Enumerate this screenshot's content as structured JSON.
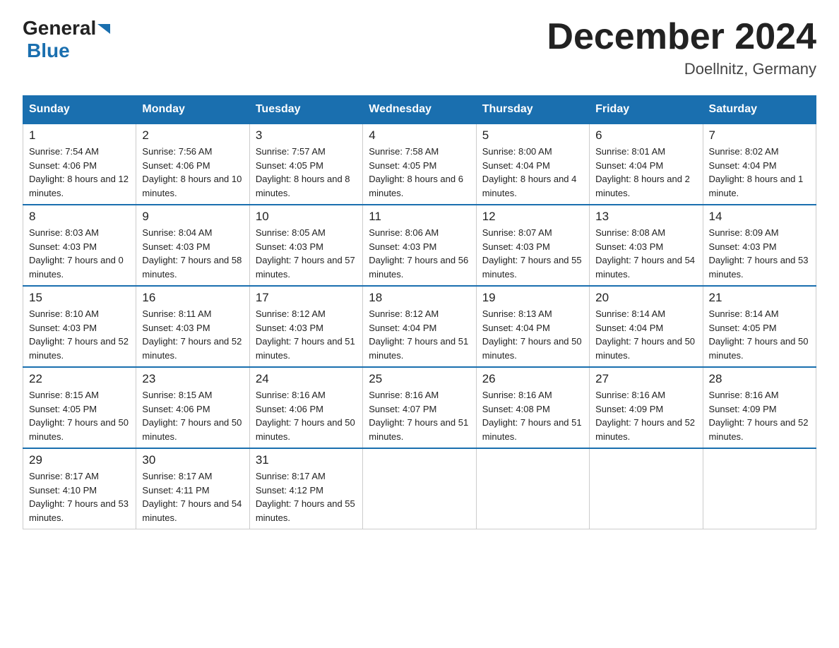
{
  "header": {
    "logo_text_general": "General",
    "logo_text_blue": "Blue",
    "title": "December 2024",
    "subtitle": "Doellnitz, Germany"
  },
  "days_of_week": [
    "Sunday",
    "Monday",
    "Tuesday",
    "Wednesday",
    "Thursday",
    "Friday",
    "Saturday"
  ],
  "weeks": [
    [
      {
        "day": "1",
        "sunrise": "7:54 AM",
        "sunset": "4:06 PM",
        "daylight": "8 hours and 12 minutes."
      },
      {
        "day": "2",
        "sunrise": "7:56 AM",
        "sunset": "4:06 PM",
        "daylight": "8 hours and 10 minutes."
      },
      {
        "day": "3",
        "sunrise": "7:57 AM",
        "sunset": "4:05 PM",
        "daylight": "8 hours and 8 minutes."
      },
      {
        "day": "4",
        "sunrise": "7:58 AM",
        "sunset": "4:05 PM",
        "daylight": "8 hours and 6 minutes."
      },
      {
        "day": "5",
        "sunrise": "8:00 AM",
        "sunset": "4:04 PM",
        "daylight": "8 hours and 4 minutes."
      },
      {
        "day": "6",
        "sunrise": "8:01 AM",
        "sunset": "4:04 PM",
        "daylight": "8 hours and 2 minutes."
      },
      {
        "day": "7",
        "sunrise": "8:02 AM",
        "sunset": "4:04 PM",
        "daylight": "8 hours and 1 minute."
      }
    ],
    [
      {
        "day": "8",
        "sunrise": "8:03 AM",
        "sunset": "4:03 PM",
        "daylight": "7 hours and 0 minutes."
      },
      {
        "day": "9",
        "sunrise": "8:04 AM",
        "sunset": "4:03 PM",
        "daylight": "7 hours and 58 minutes."
      },
      {
        "day": "10",
        "sunrise": "8:05 AM",
        "sunset": "4:03 PM",
        "daylight": "7 hours and 57 minutes."
      },
      {
        "day": "11",
        "sunrise": "8:06 AM",
        "sunset": "4:03 PM",
        "daylight": "7 hours and 56 minutes."
      },
      {
        "day": "12",
        "sunrise": "8:07 AM",
        "sunset": "4:03 PM",
        "daylight": "7 hours and 55 minutes."
      },
      {
        "day": "13",
        "sunrise": "8:08 AM",
        "sunset": "4:03 PM",
        "daylight": "7 hours and 54 minutes."
      },
      {
        "day": "14",
        "sunrise": "8:09 AM",
        "sunset": "4:03 PM",
        "daylight": "7 hours and 53 minutes."
      }
    ],
    [
      {
        "day": "15",
        "sunrise": "8:10 AM",
        "sunset": "4:03 PM",
        "daylight": "7 hours and 52 minutes."
      },
      {
        "day": "16",
        "sunrise": "8:11 AM",
        "sunset": "4:03 PM",
        "daylight": "7 hours and 52 minutes."
      },
      {
        "day": "17",
        "sunrise": "8:12 AM",
        "sunset": "4:03 PM",
        "daylight": "7 hours and 51 minutes."
      },
      {
        "day": "18",
        "sunrise": "8:12 AM",
        "sunset": "4:04 PM",
        "daylight": "7 hours and 51 minutes."
      },
      {
        "day": "19",
        "sunrise": "8:13 AM",
        "sunset": "4:04 PM",
        "daylight": "7 hours and 50 minutes."
      },
      {
        "day": "20",
        "sunrise": "8:14 AM",
        "sunset": "4:04 PM",
        "daylight": "7 hours and 50 minutes."
      },
      {
        "day": "21",
        "sunrise": "8:14 AM",
        "sunset": "4:05 PM",
        "daylight": "7 hours and 50 minutes."
      }
    ],
    [
      {
        "day": "22",
        "sunrise": "8:15 AM",
        "sunset": "4:05 PM",
        "daylight": "7 hours and 50 minutes."
      },
      {
        "day": "23",
        "sunrise": "8:15 AM",
        "sunset": "4:06 PM",
        "daylight": "7 hours and 50 minutes."
      },
      {
        "day": "24",
        "sunrise": "8:16 AM",
        "sunset": "4:06 PM",
        "daylight": "7 hours and 50 minutes."
      },
      {
        "day": "25",
        "sunrise": "8:16 AM",
        "sunset": "4:07 PM",
        "daylight": "7 hours and 51 minutes."
      },
      {
        "day": "26",
        "sunrise": "8:16 AM",
        "sunset": "4:08 PM",
        "daylight": "7 hours and 51 minutes."
      },
      {
        "day": "27",
        "sunrise": "8:16 AM",
        "sunset": "4:09 PM",
        "daylight": "7 hours and 52 minutes."
      },
      {
        "day": "28",
        "sunrise": "8:16 AM",
        "sunset": "4:09 PM",
        "daylight": "7 hours and 52 minutes."
      }
    ],
    [
      {
        "day": "29",
        "sunrise": "8:17 AM",
        "sunset": "4:10 PM",
        "daylight": "7 hours and 53 minutes."
      },
      {
        "day": "30",
        "sunrise": "8:17 AM",
        "sunset": "4:11 PM",
        "daylight": "7 hours and 54 minutes."
      },
      {
        "day": "31",
        "sunrise": "8:17 AM",
        "sunset": "4:12 PM",
        "daylight": "7 hours and 55 minutes."
      },
      null,
      null,
      null,
      null
    ]
  ]
}
